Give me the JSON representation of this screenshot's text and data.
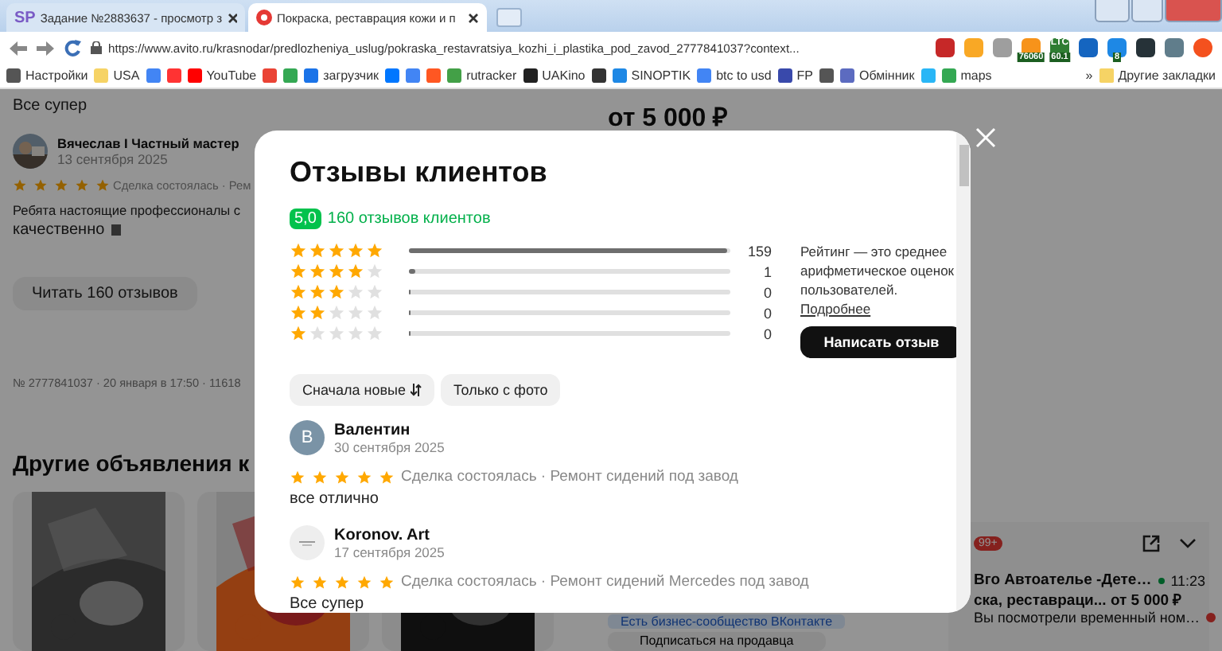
{
  "browser": {
    "tabs": [
      {
        "icon_text": "SP",
        "title": "Задание №2883637 - просмотр з",
        "selected": false
      },
      {
        "title": "Покраска, реставрация кожи и п",
        "selected": true
      }
    ],
    "url": "https://www.avito.ru/krasnodar/predlozheniya_uslug/pokraska_restavratsiya_kozhi_i_plastika_pod_zavod_2777841037?context...",
    "extensions": [
      {
        "color": "#c62828"
      },
      {
        "color": "#f9a825"
      },
      {
        "color": "#9e9e9e"
      },
      {
        "color": "#f7931a",
        "badge": "76060"
      },
      {
        "color": "#2e7d32",
        "label": "LTC",
        "badge": "60.1"
      },
      {
        "color": "#1565c0"
      },
      {
        "color": "#1e88e5",
        "badge": "8"
      },
      {
        "color": "#263238"
      },
      {
        "color": "#607d8b"
      }
    ],
    "bookmarks": [
      {
        "label": "Настройки",
        "color": "#555555"
      },
      {
        "label": "USA",
        "color": "#f6d365"
      },
      {
        "color": "#4285f4"
      },
      {
        "color": "#ff3333"
      },
      {
        "label": "YouTube",
        "color": "#ff0000"
      },
      {
        "color": "#ea4335"
      },
      {
        "color": "#34a853"
      },
      {
        "label": "загрузчик",
        "color": "#1a73e8"
      },
      {
        "color": "#0077ff"
      },
      {
        "color": "#4285f4"
      },
      {
        "color": "#ff5722"
      },
      {
        "label": "rutracker",
        "color": "#43a047"
      },
      {
        "label": "UAKino",
        "color": "#212121"
      },
      {
        "color": "#333333"
      },
      {
        "label": "SINOPTIK",
        "color": "#1e88e5"
      },
      {
        "label": "btc to usd",
        "color": "#4285f4"
      },
      {
        "label": "FP",
        "color": "#3949ab"
      },
      {
        "color": "#555555"
      },
      {
        "label": "Обмінник",
        "color": "#5c6bc0"
      },
      {
        "color": "#29b6f6"
      },
      {
        "label": "maps",
        "color": "#34a853"
      }
    ],
    "more": "»",
    "other_bookmarks": "Другие закладки"
  },
  "page": {
    "prev_review_text": "Все супер",
    "reviewer": {
      "name": "Вячеслав I Частный мастер",
      "date": "13 сентября 2025",
      "stars": 5,
      "tags": "Сделка состоялась · Рем",
      "text": "Ребята настоящие профессионалы с",
      "text_2": "качественно"
    },
    "read_button": "Читать 160 отзывов",
    "meta": "№ 2777841037 · 20 января в 17:50 · 11618",
    "other_heading": "Другие объявления к",
    "price": "от 5 000 ₽",
    "vk_note": "Есть бизнес-сообщество ВКонтакте",
    "subscribe_button": "Подписаться на продавца",
    "chat": {
      "badge": "99+",
      "title": "Вго Автоателье -Дете…",
      "online": true,
      "time": "11:23",
      "subtitle": "ска, реставраци... от 5 000 ₽",
      "message": "Вы посмотрели временный ном…",
      "unread": true
    }
  },
  "modal": {
    "title": "Отзывы клиентов",
    "score": "5,0",
    "count_link": "160 отзывов клиентов",
    "distribution": [
      {
        "stars": 5,
        "level": 0.99,
        "count": "159"
      },
      {
        "stars": 4,
        "level": 0.02,
        "count": "1"
      },
      {
        "stars": 3,
        "level": 0,
        "count": "0"
      },
      {
        "stars": 2,
        "level": 0,
        "count": "0"
      },
      {
        "stars": 1,
        "level": 0,
        "count": "0"
      }
    ],
    "info": "Рейтинг — это среднее арифметическое оценок пользователей.",
    "info_link": "Подробнее",
    "write_button": "Написать отзыв",
    "filters": [
      {
        "label": "Сначала новые",
        "sort": true
      },
      {
        "label": "Только с фото",
        "sort": false
      }
    ],
    "reviews": [
      {
        "avatar": {
          "kind": "letter",
          "letter": "В"
        },
        "name": "Валентин",
        "date": "30 сентября 2025",
        "stars": 5,
        "tags": "Сделка состоялась · Ремонт сидений под завод",
        "text": "все отлично"
      },
      {
        "avatar": {
          "kind": "logo"
        },
        "name": "Koronov. Art",
        "date": "17 сентября 2025",
        "stars": 5,
        "tags": "Сделка состоялась · Ремонт сидений Mercedes под завод",
        "text": "Все супер"
      }
    ]
  }
}
